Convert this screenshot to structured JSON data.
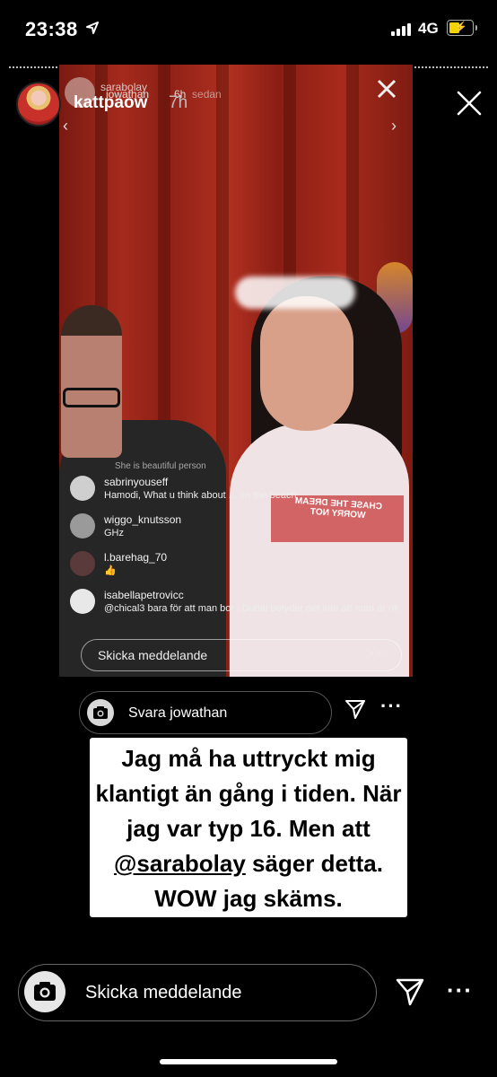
{
  "status_bar": {
    "time": "23:38",
    "network": "4G"
  },
  "story": {
    "username": "kattpaow",
    "time_ago": "7h"
  },
  "embedded": {
    "header_user_top": "sarabolay",
    "header_user": "jowathan",
    "header_time": "6h",
    "header_extra": "sedan",
    "shirt_text": "CHASE THE DREAM WORRY NOT",
    "comments": [
      {
        "user": "sabrinyouseff",
        "text": "Hamodi, What u think about ... on the beach",
        "avatar_color": "#cfcfcf",
        "faded_line": "She is beautiful person"
      },
      {
        "user": "wiggo_knutsson",
        "text": "GHz",
        "avatar_color": "#9a9a9a"
      },
      {
        "user": "l.barehag_70",
        "text": "👍",
        "avatar_color": "#5a3a3a"
      },
      {
        "user": "isabellapetrovicc",
        "text": "@chical3 bara för att man bor i Dubai betyder det inte att man är rik",
        "avatar_color": "#e8e8e8"
      }
    ],
    "input_placeholder": "Skicka meddelande"
  },
  "reply": {
    "placeholder": "Svara jowathan"
  },
  "caption": {
    "before": "Jag må ha uttryckt mig klantigt än gång i tiden. När jag var typ 16. Men att ",
    "mention": "@sarabolay",
    "after": " säger detta. WOW jag skäms."
  },
  "message_bar": {
    "placeholder": "Skicka meddelande"
  },
  "colors": {
    "background": "#000000",
    "battery": "#f5d300",
    "caption_bg": "#ffffff"
  }
}
